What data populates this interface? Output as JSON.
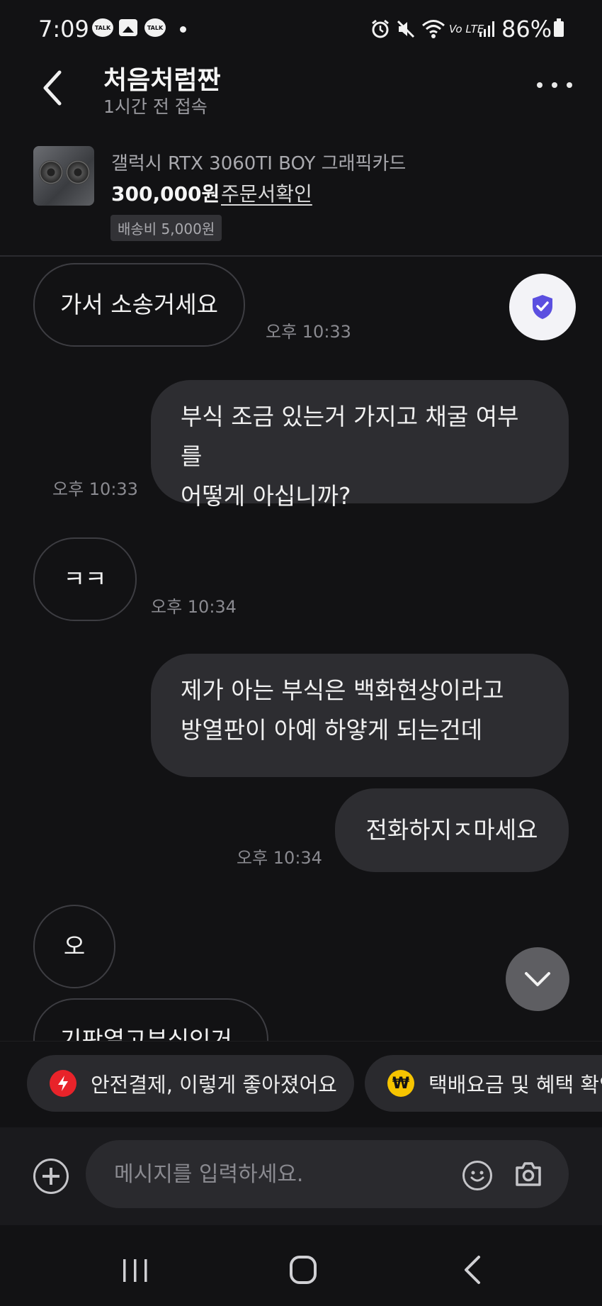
{
  "status_bar": {
    "time": "7:09",
    "talk_badge": "TALK",
    "battery": "86%",
    "lte_label": "Vo LTE"
  },
  "header": {
    "title": "처음처럼짠",
    "subtitle": "1시간 전 접속"
  },
  "product": {
    "name": "갤럭시 RTX 3060TI BOY 그래픽카드",
    "price": "300,000원",
    "order_link": "주문서확인",
    "shipping": "배송비 5,000원"
  },
  "messages": [
    {
      "side": "in",
      "text": "가서 소송거세요",
      "time": "오후 10:33"
    },
    {
      "side": "out",
      "line1": "부식 조금 있는거 가지고 채굴 여부를",
      "line2": "어떻게 아십니까?",
      "time": "오후 10:33"
    },
    {
      "side": "in",
      "text": "ㅋㅋ",
      "time": "오후 10:34"
    },
    {
      "side": "out",
      "line1": "제가 아는 부식은 백화현상이라고",
      "line2": "방열판이 아예 하얗게 되는건데"
    },
    {
      "side": "out",
      "text": "전화하지ㅈ마세요",
      "time": "오후 10:34"
    },
    {
      "side": "in",
      "text": "오"
    },
    {
      "side": "in",
      "text": "기판열고부식인거"
    }
  ],
  "chips": [
    {
      "label": "안전결제, 이렇게 좋아졌어요",
      "icon": "lightning-icon",
      "color": "#e8232a"
    },
    {
      "label": "택배요금 및 혜택 확인",
      "icon": "won-icon",
      "color": "#f6c400"
    }
  ],
  "input": {
    "placeholder": "메시지를 입력하세요."
  },
  "colors": {
    "background": "#121214",
    "bubble_out": "#2d2d31",
    "bubble_in_border": "#3d3d42",
    "shield_accent": "#5b4fe0"
  }
}
